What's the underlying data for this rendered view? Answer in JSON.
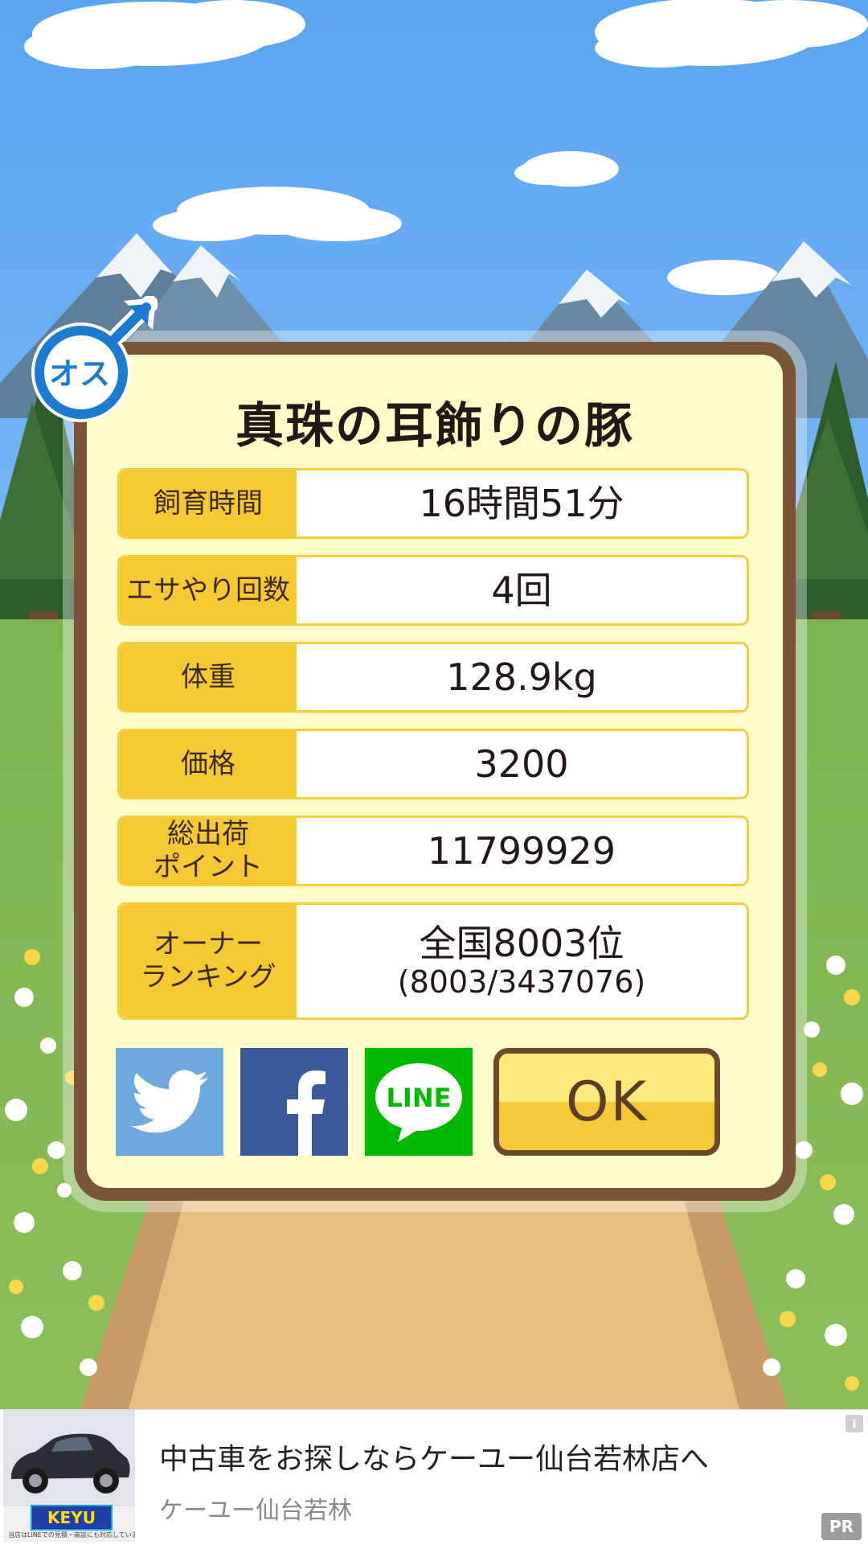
{
  "pig": {
    "name": "真珠の耳飾りの豚",
    "gender_badge": "オス"
  },
  "stats": [
    {
      "label": "飼育時間",
      "value": "16時間51分"
    },
    {
      "label": "エサやり回数",
      "value": "4回"
    },
    {
      "label": "体重",
      "value": "128.9kg"
    },
    {
      "label": "価格",
      "value": "3200"
    },
    {
      "label": "総出荷\nポイント",
      "value": "11799929"
    },
    {
      "label": "オーナー\nランキング",
      "value": "全国8003位",
      "sub": "(8003/3437076)"
    }
  ],
  "actions": {
    "ok_label": "OK",
    "line_label": "LINE",
    "twitter_icon": "twitter-icon",
    "facebook_icon": "facebook-icon"
  },
  "ad": {
    "headline": "中古車をお探しならケーユー仙台若林店へ",
    "advertiser": "ケーユー仙台若林",
    "logo_text": "KEYU",
    "caption": "当店はLINEでの見積・商談にも対応しています。",
    "info": "i",
    "pr": "PR"
  },
  "colors": {
    "sky": "#6fb1f2",
    "card_border": "#7a5638",
    "card_fill": "#fffdc9",
    "label_fill": "#f6c933",
    "twitter": "#6ea8dc",
    "facebook": "#3b5998",
    "line": "#00b900"
  }
}
